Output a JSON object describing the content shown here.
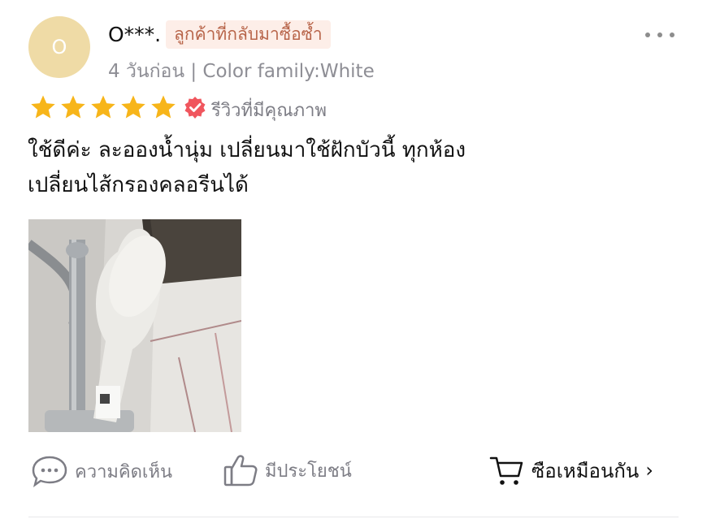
{
  "review": {
    "avatar_letter": "O",
    "username": "O***.",
    "badge": "ลูกค้าที่กลับมาซื้อซ้ำ",
    "meta": "4 วันก่อน | Color family:White",
    "rating": 5,
    "rating_max": 5,
    "quality_label": "รีวิวที่มีคุณภาพ",
    "text_line1": "ใช้ดีค่ะ ละอองน้ำนุ่ม เปลี่ยนมาใช้ฝักบัวนี้ ทุกห้อง",
    "text_line2": "เปลี่ยนไส้กรองคลอรีนได้"
  },
  "actions": {
    "comment_label": "ความคิดเห็น",
    "helpful_label": "มีประโยชน์",
    "buy_label": "ซือเหมือนกัน",
    "buy_chevron": "›"
  },
  "icons": {
    "more": "more-dots-icon",
    "star": "star-icon",
    "verified": "verified-badge-icon",
    "comment": "comment-bubble-icon",
    "helpful": "thumbs-up-icon",
    "cart": "shopping-cart-icon"
  },
  "colors": {
    "star": "#f7b51a",
    "verified": "#f0565e",
    "badge_bg": "#fdeee8",
    "badge_text": "#b8654a",
    "avatar_bg": "#efdba6",
    "muted_text": "#8e8e95"
  }
}
